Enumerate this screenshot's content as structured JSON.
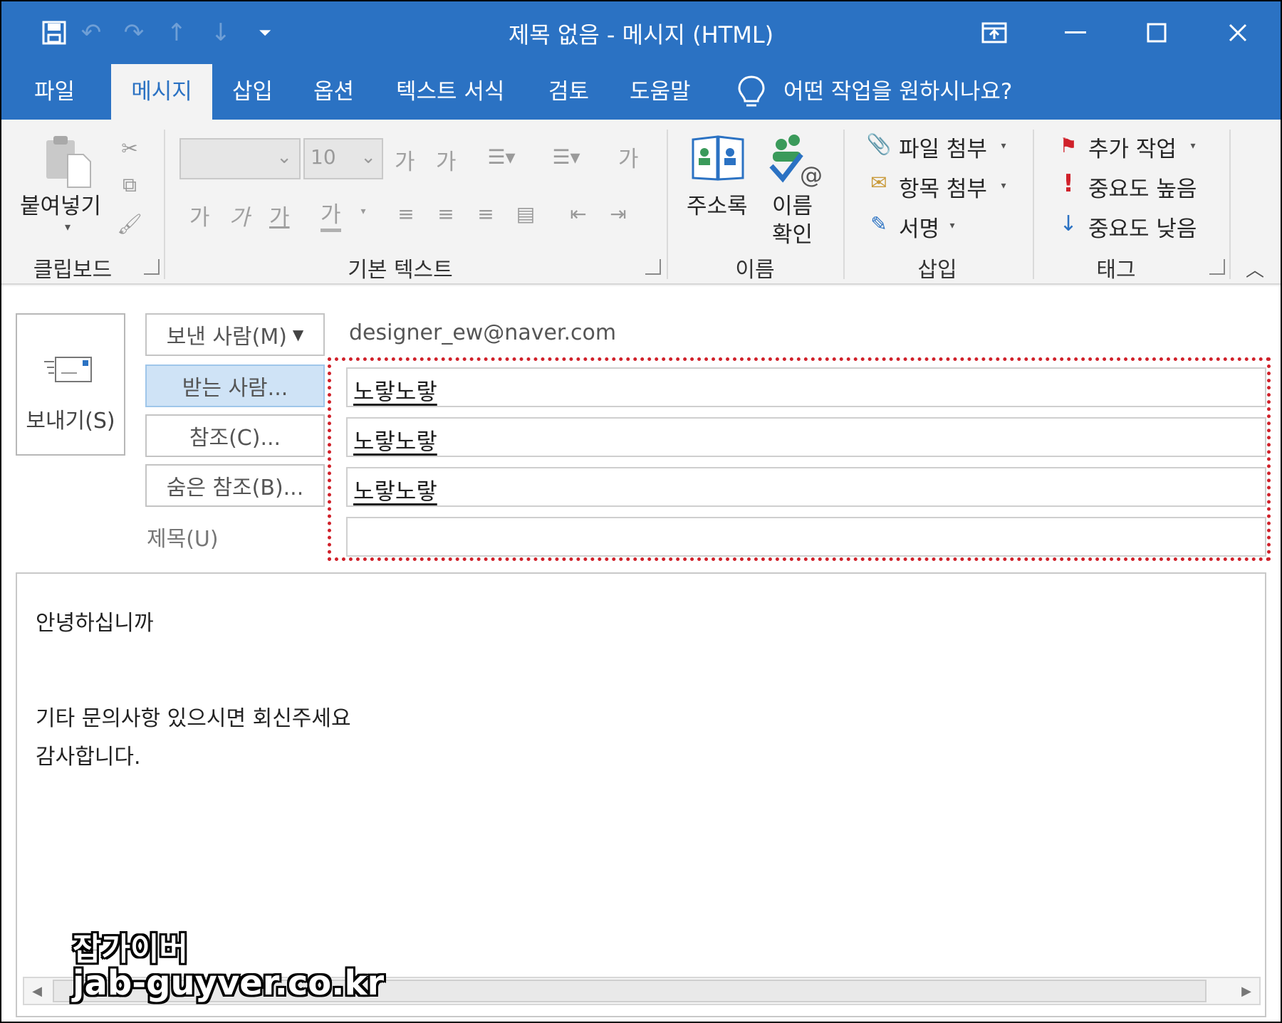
{
  "window": {
    "title": "제목 없음  -  메시지 (HTML)"
  },
  "quick_access": [
    {
      "icon": "save-icon"
    },
    {
      "icon": "undo-icon"
    },
    {
      "icon": "redo-icon"
    },
    {
      "icon": "up-arrow-icon"
    },
    {
      "icon": "down-arrow-icon"
    },
    {
      "icon": "customize-dropdown-icon"
    }
  ],
  "tabs": [
    "파일",
    "메시지",
    "삽입",
    "옵션",
    "텍스트 서식",
    "검토",
    "도움말"
  ],
  "active_tab": "메시지",
  "tell_me": "어떤 작업을 원하시나요?",
  "ribbon": {
    "clipboard": {
      "paste": "붙여넣기",
      "group": "클립보드"
    },
    "basic_text": {
      "font_size": "10",
      "grow_font": "가",
      "shrink_font": "가",
      "clear_format": "가",
      "bold": "가",
      "italic": "가",
      "underline": "가",
      "font_color": "가",
      "group": "기본 텍스트"
    },
    "names": {
      "address_book": "주소록",
      "check_names_1": "이름",
      "check_names_2": "확인",
      "group": "이름"
    },
    "include": {
      "attach_file": "파일 첨부",
      "attach_item": "항목 첨부",
      "signature": "서명",
      "group": "삽입"
    },
    "tags": {
      "follow_up": "추가 작업",
      "high_importance": "중요도 높음",
      "low_importance": "중요도 낮음",
      "group": "태그"
    }
  },
  "compose": {
    "send": "보내기(S)",
    "from_button": "보낸 사람(M)",
    "from_address": "designer_ew@naver.com",
    "to_button": "받는 사람...",
    "cc_button": "참조(C)...",
    "bcc_button": "숨은 참조(B)...",
    "subject_label": "제목(U)",
    "to_value": "노랗노랗",
    "cc_value": "노랗노랗",
    "bcc_value": "노랗노랗",
    "subject_value": ""
  },
  "body": {
    "line1": "안녕하십니까",
    "line2": "기타 문의사항 있으시면 회신주세요",
    "line3": "감사합니다."
  },
  "watermark": {
    "line1": "잡가이버",
    "line2": "jab-guyver.co.kr"
  },
  "colors": {
    "accent": "#2b72c3",
    "highlight_border": "#d0212a"
  }
}
